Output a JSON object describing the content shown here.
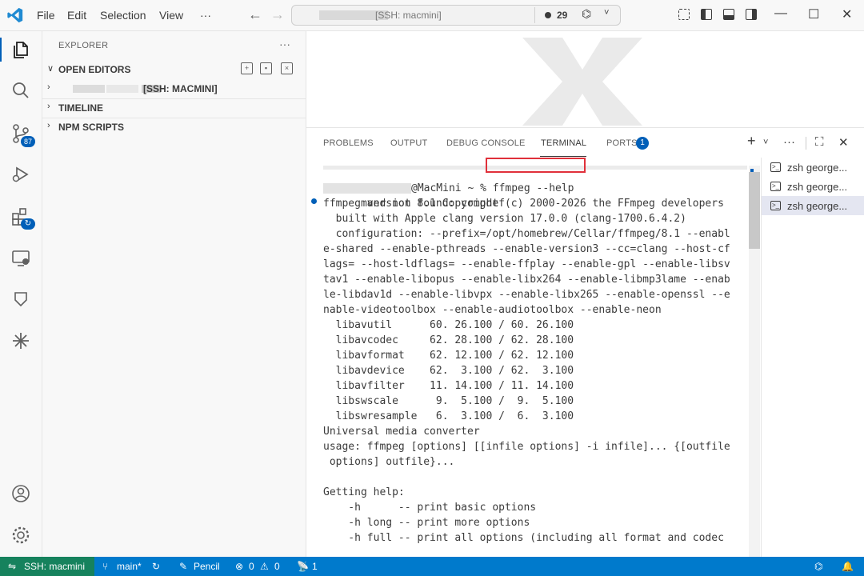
{
  "menu": [
    "File",
    "Edit",
    "Selection",
    "View",
    "···"
  ],
  "command_center": {
    "title": "[SSH: macmini]",
    "notification_count": "29",
    "copilot_icon": "copilot-icon",
    "chevron": "˅"
  },
  "window_controls": {
    "minimize": "—",
    "maximize": "☐",
    "close": "✕"
  },
  "explorer": {
    "title": "EXPLORER",
    "more": "···",
    "sections": {
      "open_editors": "OPEN EDITORS",
      "workspace": "[SSH: MACMINI]",
      "timeline": "TIMELINE",
      "npm_scripts": "NPM SCRIPTS"
    }
  },
  "activity_badges": {
    "source_control": "87"
  },
  "panel": {
    "tabs": [
      "PROBLEMS",
      "OUTPUT",
      "DEBUG CONSOLE",
      "TERMINAL",
      "PORTS"
    ],
    "active_tab": "TERMINAL",
    "ports_badge": "1",
    "actions": {
      "new": "+",
      "dropdown": "˅",
      "more": "···",
      "maximize": "⛶",
      "close": "✕"
    }
  },
  "terminal": {
    "lines": [
      "mand not found: compdef",
      "@MacMini ~ % ffmpeg --help",
      "ffmpeg version 8.1 Copyright (c) 2000-2026 the FFmpeg developers",
      "  built with Apple clang version 17.0.0 (clang-1700.6.4.2)",
      "  configuration: --prefix=/opt/homebrew/Cellar/ffmpeg/8.1 --enabl",
      "e-shared --enable-pthreads --enable-version3 --cc=clang --host-cf",
      "lags= --host-ldflags= --enable-ffplay --enable-gpl --enable-libsv",
      "tav1 --enable-libopus --enable-libx264 --enable-libmp3lame --enab",
      "le-libdav1d --enable-libvpx --enable-libx265 --enable-openssl --e",
      "nable-videotoolbox --enable-audiotoolbox --enable-neon",
      "  libavutil      60. 26.100 / 60. 26.100",
      "  libavcodec     62. 28.100 / 62. 28.100",
      "  libavformat    62. 12.100 / 62. 12.100",
      "  libavdevice    62.  3.100 / 62.  3.100",
      "  libavfilter    11. 14.100 / 11. 14.100",
      "  libswscale      9.  5.100 /  9.  5.100",
      "  libswresample   6.  3.100 /  6.  3.100",
      "Universal media converter",
      "usage: ffmpeg [options] [[infile options] -i infile]... {[outfile",
      " options] outfile}...",
      "",
      "Getting help:",
      "    -h      -- print basic options",
      "    -h long -- print more options",
      "    -h full -- print all options (including all format and codec"
    ],
    "prompt_suffix": "@MacMini ~ % ",
    "highlighted_command": "ffmpeg --help"
  },
  "terminal_list": [
    "zsh george...",
    "zsh george...",
    "zsh george..."
  ],
  "statusbar": {
    "remote": "SSH: macmini",
    "branch": "main*",
    "pencil": "Pencil",
    "errors": "0",
    "warnings": "0",
    "ports": "1"
  }
}
